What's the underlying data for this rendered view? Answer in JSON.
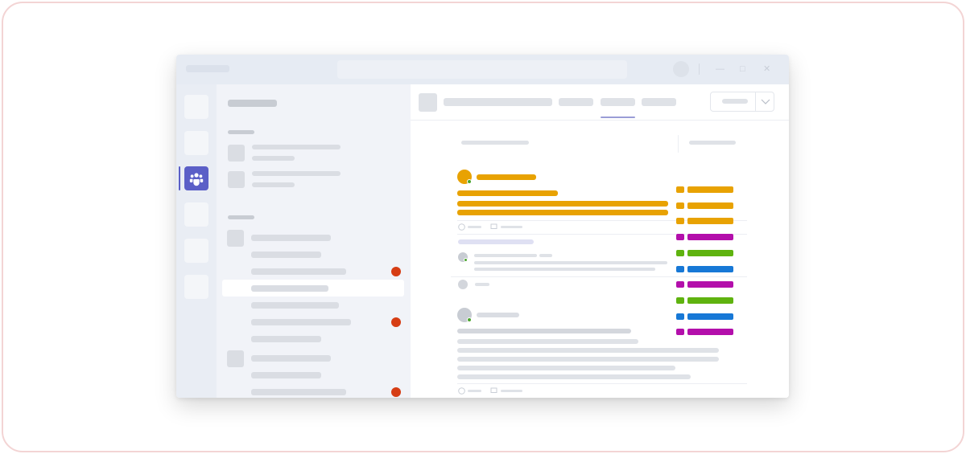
{
  "colors": {
    "accent": "#5b5fc7",
    "amber": "#e8a202",
    "magenta": "#b30fab",
    "green": "#5fb30f",
    "blue": "#1778d6",
    "unread": "#d63d14",
    "presence": "#4aa52d"
  },
  "rail": {
    "active_icon": "teams-people-icon"
  },
  "window_controls": {
    "minimize": "—",
    "maximize": "□",
    "close": "✕"
  },
  "tag_list": [
    {
      "color": "amber"
    },
    {
      "color": "amber"
    },
    {
      "color": "amber"
    },
    {
      "color": "magenta"
    },
    {
      "color": "green"
    },
    {
      "color": "blue"
    },
    {
      "color": "magenta"
    },
    {
      "color": "green"
    },
    {
      "color": "blue"
    },
    {
      "color": "magenta"
    }
  ]
}
